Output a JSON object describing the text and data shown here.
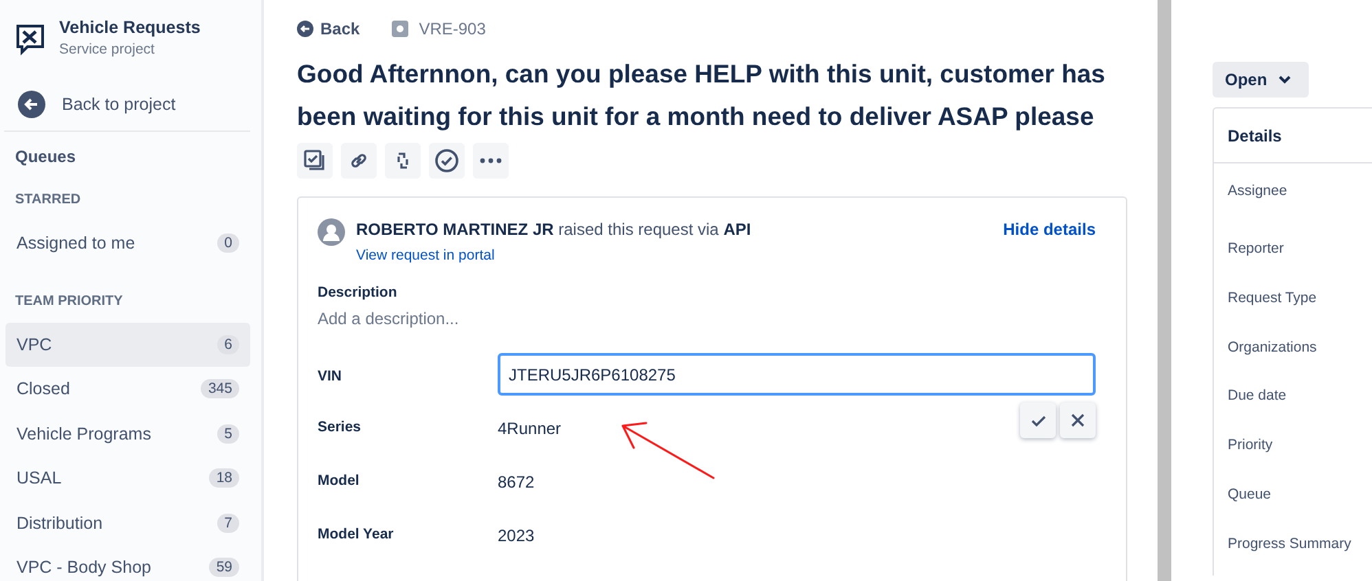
{
  "sidebar": {
    "project": {
      "title": "Vehicle Requests",
      "subtitle": "Service project"
    },
    "back_link": "Back to project",
    "queues_label": "Queues",
    "sections": [
      {
        "heading": "STARRED",
        "items": [
          {
            "label": "Assigned to me",
            "count": "0",
            "selected": false
          }
        ]
      },
      {
        "heading": "TEAM PRIORITY",
        "items": [
          {
            "label": "VPC",
            "count": "6",
            "selected": true
          },
          {
            "label": "Closed",
            "count": "345",
            "selected": false
          },
          {
            "label": "Vehicle Programs",
            "count": "5",
            "selected": false
          },
          {
            "label": "USAL",
            "count": "18",
            "selected": false
          },
          {
            "label": "Distribution",
            "count": "7",
            "selected": false
          },
          {
            "label": "VPC - Body Shop",
            "count": "59",
            "selected": false
          }
        ]
      }
    ]
  },
  "issue": {
    "back": "Back",
    "key": "VRE-903",
    "title": "Good Afternnon, can you please HELP with this unit, customer has been waiting for this unit for a month need to deliver ASAP please",
    "request": {
      "raised_by": "**ROBERTO MARTINEZ JR** raised this request via **API**",
      "portal_link": "View request in portal",
      "hide_details": "Hide details"
    },
    "description": {
      "label": "Description",
      "placeholder": "Add a description..."
    },
    "fields": [
      {
        "label": "VIN",
        "value": "JTERU5JR6P6108275",
        "kind": "input"
      },
      {
        "label": "Series",
        "value": "4Runner",
        "kind": "text"
      },
      {
        "label": "Model",
        "value": "8672",
        "kind": "text"
      },
      {
        "label": "Model Year",
        "value": "2023",
        "kind": "text"
      }
    ]
  },
  "side_panel": {
    "status": "Open",
    "details_heading": "Details",
    "fields": [
      "Assignee",
      "Reporter",
      "Request Type",
      "Organizations",
      "Due date",
      "Priority",
      "Queue",
      "Progress Summary"
    ]
  }
}
